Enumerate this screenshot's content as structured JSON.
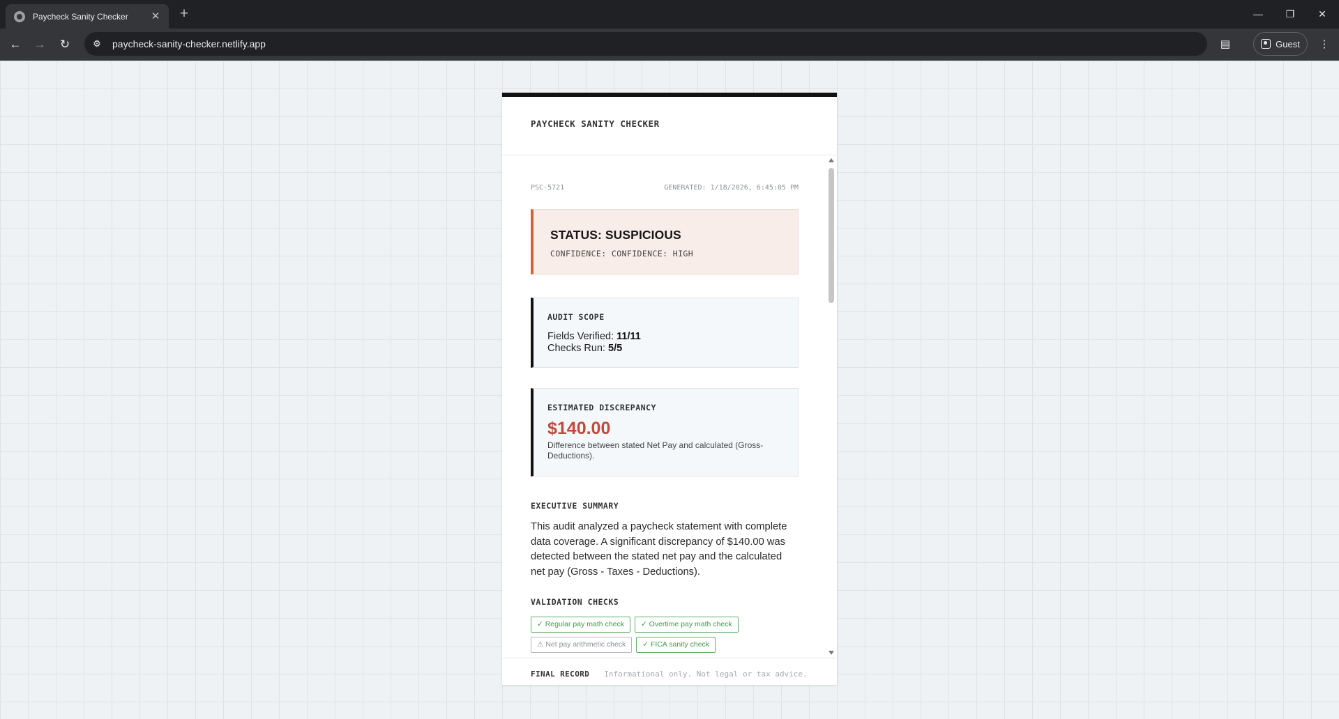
{
  "browser": {
    "tab_title": "Paycheck Sanity Checker",
    "tab_close": "✕",
    "new_tab": "+",
    "url": "paycheck-sanity-checker.netlify.app",
    "profile_label": "Guest"
  },
  "app": {
    "title": "PAYCHECK SANITY CHECKER"
  },
  "report": {
    "id": "PSC-5721",
    "generated": "GENERATED: 1/18/2026, 6:45:05 PM"
  },
  "status": {
    "title": "STATUS: SUSPICIOUS",
    "confidence": "CONFIDENCE: CONFIDENCE: HIGH",
    "accent_color": "#c9643f"
  },
  "audit_scope": {
    "label": "AUDIT SCOPE",
    "fields_label": "Fields Verified:",
    "fields_value": "11/11",
    "checks_label": "Checks Run:",
    "checks_value": "5/5"
  },
  "discrepancy": {
    "label": "ESTIMATED DISCREPANCY",
    "amount": "$140.00",
    "description": "Difference between stated Net Pay and calculated (Gross-Deductions).",
    "amount_color": "#c0493c"
  },
  "executive_summary": {
    "label": "EXECUTIVE SUMMARY",
    "text": "This audit analyzed a paycheck statement with complete data coverage. A significant discrepancy of $140.00 was detected between the stated net pay and the calculated net pay (Gross - Taxes - Deductions)."
  },
  "validation_checks": {
    "label": "VALIDATION CHECKS",
    "items": [
      {
        "label": "✓ Regular pay math check",
        "state": "pass"
      },
      {
        "label": "✓ Overtime pay math check",
        "state": "pass"
      },
      {
        "label": "⚠ Net pay arithmetic check",
        "state": "warn"
      },
      {
        "label": "✓ FICA sanity check",
        "state": "pass"
      }
    ]
  },
  "footer": {
    "label": "FINAL RECORD",
    "note": "Informational only. Not legal or tax advice."
  }
}
